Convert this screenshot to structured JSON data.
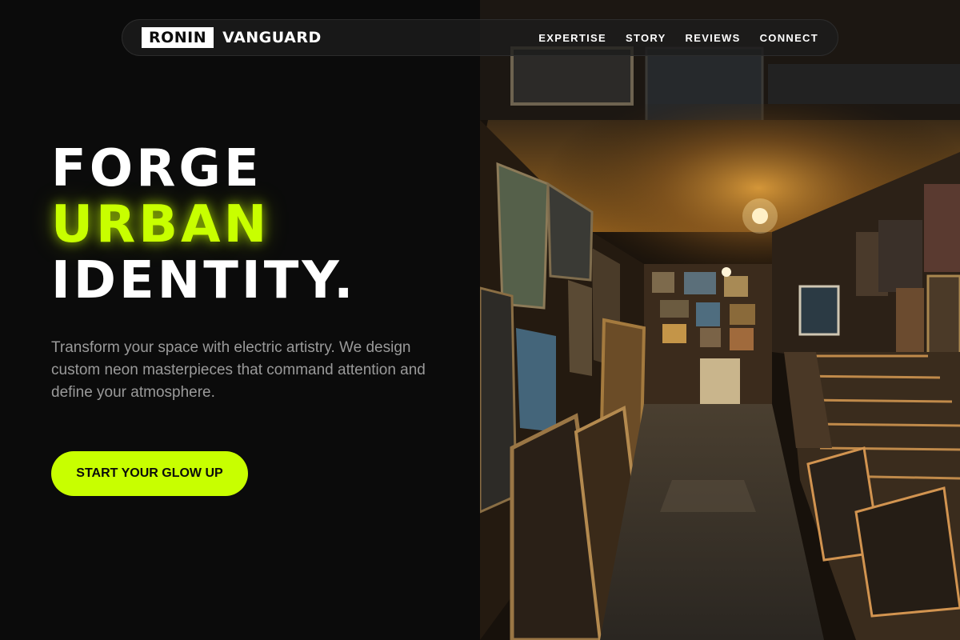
{
  "brand": {
    "box_text": "RONIN",
    "name": "VANGUARD"
  },
  "nav": {
    "links": [
      "EXPERTISE",
      "STORY",
      "REVIEWS",
      "CONNECT"
    ]
  },
  "hero": {
    "title_line1": "FORGE",
    "title_line2": "URBAN",
    "title_line3": "IDENTITY.",
    "subtitle": "Transform your space with electric artistry. We design custom neon masterpieces that command attention and define your atmosphere.",
    "cta_label": "START YOUR GLOW UP"
  },
  "colors": {
    "accent": "#c8ff00",
    "background": "#0b0b0b",
    "subtitle": "#9a9a9a"
  },
  "image": {
    "subject": "dim corridor of an art shop lined with framed paintings under hanging light bulbs"
  }
}
